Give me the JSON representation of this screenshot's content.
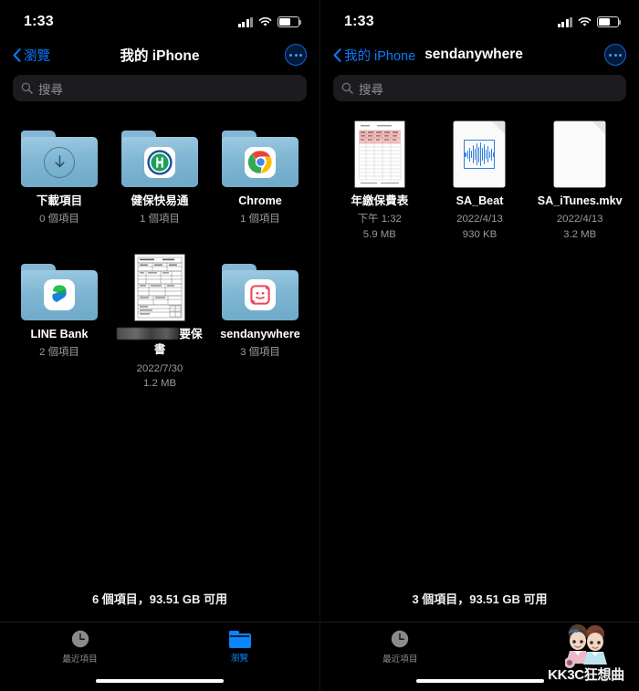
{
  "colors": {
    "accent_blue": "#0a84ff",
    "background": "#000000",
    "folder_blue": "#7fb6d3",
    "search_field": "#1c1c1e",
    "secondary_text": "#9b9b9b"
  },
  "left": {
    "status": {
      "time": "1:33",
      "signal_icon": "cellular-bars-icon",
      "wifi_icon": "wifi-icon",
      "battery_icon": "battery-icon",
      "battery_level": "62%"
    },
    "nav": {
      "back_label": "瀏覽",
      "back_icon": "chevron-left-icon",
      "title": "我的 iPhone",
      "more_icon": "more-ellipsis-icon"
    },
    "search": {
      "placeholder": "搜尋",
      "value": "",
      "icon": "search-icon"
    },
    "items": [
      {
        "name": "下載項目",
        "meta1": "0 個項目",
        "meta2": "",
        "kind": "folder",
        "icon": "download-arrow-icon",
        "redacted": false
      },
      {
        "name": "健保快易通",
        "meta1": "1 個項目",
        "meta2": "",
        "kind": "folder",
        "icon": "nhi-app-icon",
        "redacted": false
      },
      {
        "name": "Chrome",
        "meta1": "1 個項目",
        "meta2": "",
        "kind": "folder",
        "icon": "chrome-app-icon",
        "redacted": false
      },
      {
        "name": "LINE Bank",
        "meta1": "2 個項目",
        "meta2": "",
        "kind": "folder",
        "icon": "line-bank-app-icon",
        "redacted": false
      },
      {
        "name": "要保書",
        "meta1": "2022/7/30",
        "meta2": "1.2 MB",
        "kind": "document-page",
        "icon": "form-document-thumbnail",
        "redacted": true
      },
      {
        "name": "sendanywhere",
        "meta1": "3 個項目",
        "meta2": "",
        "kind": "folder",
        "icon": "send-anywhere-app-icon",
        "redacted": false
      }
    ],
    "footer_status": "6 個項目，93.51 GB 可用",
    "tabs": [
      {
        "label": "最近項目",
        "icon": "clock-icon",
        "active": false
      },
      {
        "label": "瀏覽",
        "icon": "folder-icon",
        "active": true
      }
    ]
  },
  "right": {
    "status": {
      "time": "1:33",
      "signal_icon": "cellular-bars-icon",
      "wifi_icon": "wifi-icon",
      "battery_icon": "battery-icon",
      "battery_level": "62%"
    },
    "nav": {
      "back_label": "我的 iPhone",
      "back_icon": "chevron-left-icon",
      "title": "sendanywhere",
      "more_icon": "more-ellipsis-icon"
    },
    "search": {
      "placeholder": "搜尋",
      "value": "",
      "icon": "search-icon"
    },
    "items": [
      {
        "name": "年繳保費表",
        "meta1": "下午 1:32",
        "meta2": "5.9 MB",
        "kind": "spreadsheet",
        "icon": "spreadsheet-thumbnail"
      },
      {
        "name": "SA_Beat",
        "meta1": "2022/4/13",
        "meta2": "930 KB",
        "kind": "audio",
        "icon": "audio-waveform-icon"
      },
      {
        "name": "SA_iTunes.mkv",
        "meta1": "2022/4/13",
        "meta2": "3.2 MB",
        "kind": "generic",
        "icon": "blank-document-icon"
      }
    ],
    "footer_status": "3 個項目，93.51 GB 可用",
    "tabs": [
      {
        "label": "最近項目",
        "icon": "clock-icon",
        "active": false
      }
    ],
    "watermark": {
      "text": "KK3C狂想曲",
      "icon": "couple-mascot-icon"
    }
  }
}
